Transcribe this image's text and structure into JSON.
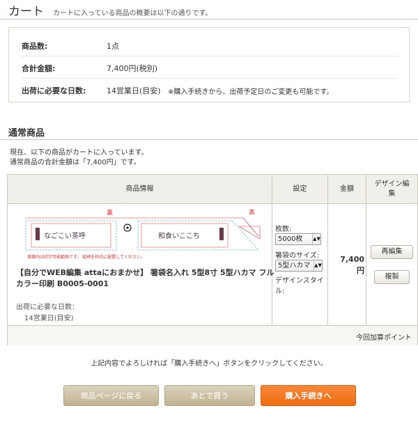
{
  "header": {
    "title": "カート",
    "subtitle": "カートに入っている商品の概要は以下の通りです。"
  },
  "summary": {
    "count_label": "商品数:",
    "count_value": "1点",
    "total_label": "合計金額:",
    "total_value": "7,400円(税別)",
    "days_label": "出荷に必要な日数:",
    "days_value": "14営業日(目安)",
    "days_note": "※購入手続きから、出荷予定日のご変更も可能です。"
  },
  "section": {
    "title": "通常商品",
    "intro_line1": "現在、以下の商品がカートに入っています。",
    "intro_line2": "通常商品の合計金額は「7,400円」です。"
  },
  "table": {
    "headers": {
      "product": "商品情報",
      "settings": "設定",
      "amount": "金額",
      "design_edit_line1": "デザイン編",
      "design_edit_line2": "集"
    },
    "item": {
      "design_preview": {
        "back_label": "裏",
        "front_label": "表",
        "back_text": "なごこい茶呼",
        "front_text": "和食いここち",
        "warning": "背面内は印字可能範囲です。 絵柄を枠内に配置してください。"
      },
      "name": "【自分でWEB編集 attaにおまかせ】 箸袋名入れ 5型8寸 5型ハカマ フルカラー印刷 B0005-0001",
      "ship_label": "出荷に必要な日数：",
      "ship_value": "14営業日(目安)",
      "qty_label": "枚数:",
      "qty_value": "5000枚",
      "size_label": "箸袋のサイズ:",
      "size_value": "5型ハカマ",
      "style_label": "デザインスタイル:",
      "price_value": "7,400",
      "price_unit": "円",
      "reedit_button": "再編集",
      "duplicate_button": "複製"
    },
    "footer_text": "今回加算ポイント"
  },
  "instruction": "上記内容でよろしければ「購入手続きへ」ボタンをクリックしてください。",
  "buttons": {
    "back": "商品ページに戻る",
    "later": "あとで買う",
    "checkout": "購入手続きへ"
  },
  "colors": {
    "accent_orange": "#ef6c12",
    "tan_button": "#cfc5a8",
    "table_header_bg": "#f1efe9",
    "border": "#cfc7b6",
    "guide_red": "#d9302c",
    "guide_blue": "#4aa3d8"
  }
}
